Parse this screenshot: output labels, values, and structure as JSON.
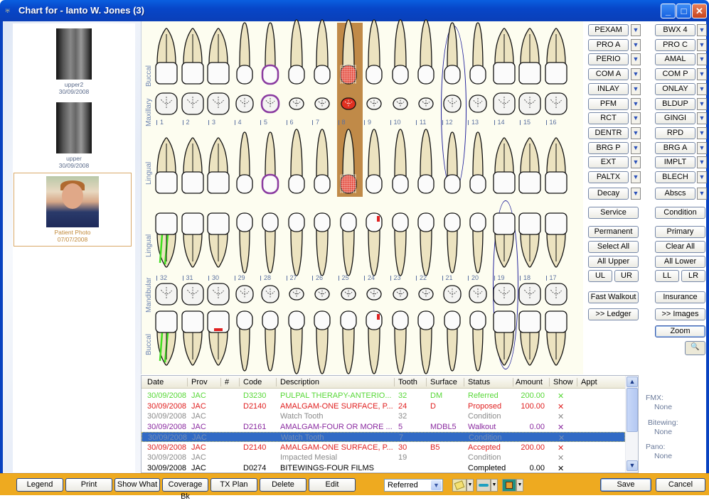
{
  "window": {
    "title": "Chart for - Ianto W. Jones (3)",
    "controls": {
      "minimize": "_",
      "maximize": "□",
      "close": "✕"
    }
  },
  "images_panel": {
    "items": [
      {
        "label": "upper2",
        "date": "30/09/2008",
        "type": "xray"
      },
      {
        "label": "upper",
        "date": "30/09/2008",
        "type": "xray"
      },
      {
        "label": "Patient Photo",
        "date": "07/07/2008",
        "type": "photo",
        "selected": true
      }
    ]
  },
  "chart": {
    "labels": {
      "upper_buccal": "Buccal",
      "maxillary": "Maxillary",
      "upper_lingual": "Lingual",
      "lower_lingual": "Lingual",
      "mandibular": "Mandibular",
      "lower_buccal": "Buccal"
    },
    "upper_teeth": [
      "1",
      "2",
      "3",
      "4",
      "5",
      "6",
      "7",
      "8",
      "9",
      "10",
      "11",
      "12",
      "13",
      "14",
      "15",
      "16"
    ],
    "lower_teeth": [
      "32",
      "31",
      "30",
      "29",
      "28",
      "27",
      "26",
      "25",
      "24",
      "23",
      "22",
      "21",
      "20",
      "19",
      "18",
      "17"
    ],
    "selected_tooth": "8",
    "circled_teeth": [
      "12",
      "19"
    ],
    "colors": {
      "selected_bg": "#c08a48",
      "crown_pattern": "#e03020",
      "walkout": "#8a3aa0",
      "referred": "#40e020",
      "proposed": "#e02020",
      "circle": "#20209a"
    }
  },
  "procedure_buttons": {
    "left": [
      "PEXAM",
      "PRO A",
      "PERIO",
      "COM A",
      "INLAY",
      "PFM",
      "RCT",
      "DENTR",
      "BRG P",
      "EXT",
      "PALTX"
    ],
    "right": [
      "BWX 4",
      "PRO C",
      "AMAL",
      "COM P",
      "ONLAY",
      "BLDUP",
      "GINGI",
      "RPD",
      "BRG A",
      "IMPLT",
      "BLECH"
    ],
    "decay": "Decay",
    "abscs": "Abscs"
  },
  "action_buttons": {
    "service": "Service",
    "condition": "Condition",
    "permanent": "Permanent",
    "primary": "Primary",
    "select_all": "Select All",
    "clear_all": "Clear All",
    "all_upper": "All Upper",
    "all_lower": "All Lower",
    "ul": "UL",
    "ur": "UR",
    "ll": "LL",
    "lr": "LR",
    "fast_walkout": "Fast Walkout",
    "insurance": "Insurance",
    "ledger": ">> Ledger",
    "images": ">> Images",
    "zoom": "Zoom"
  },
  "table": {
    "columns": [
      "Date",
      "Prov",
      "#",
      "Code",
      "Description",
      "Tooth",
      "Surface",
      "Status",
      "Amount",
      "Show",
      "Appt"
    ],
    "rows": [
      {
        "date": "30/09/2008",
        "prov": "JAC",
        "num": "",
        "code": "D3230",
        "desc": "PULPAL THERAPY-ANTERIO...",
        "tooth": "32",
        "surface": "DM",
        "status": "Referred",
        "amount": "200.00",
        "show": "✕",
        "appt": "",
        "color": "#58d838"
      },
      {
        "date": "30/09/2008",
        "prov": "JAC",
        "num": "",
        "code": "D2140",
        "desc": "AMALGAM-ONE SURFACE, P...",
        "tooth": "24",
        "surface": "D",
        "status": "Proposed",
        "amount": "100.00",
        "show": "✕",
        "appt": "",
        "color": "#e02020"
      },
      {
        "date": "30/09/2008",
        "prov": "JAC",
        "num": "",
        "code": "",
        "desc": "Watch Tooth",
        "tooth": "32",
        "surface": "",
        "status": "Condition",
        "amount": "",
        "show": "✕",
        "appt": "",
        "color": "#8a8a8a"
      },
      {
        "date": "30/09/2008",
        "prov": "JAC",
        "num": "",
        "code": "D2161",
        "desc": "AMALGAM-FOUR OR MORE ...",
        "tooth": "5",
        "surface": "MDBL5",
        "status": "Walkout",
        "amount": "0.00",
        "show": "✕",
        "appt": "",
        "color": "#8a2aa0"
      },
      {
        "date": "30/09/2008",
        "prov": "JAC",
        "num": "",
        "code": "",
        "desc": "Watch Tooth",
        "tooth": "7",
        "surface": "",
        "status": "Condition",
        "amount": "",
        "show": "✕",
        "appt": "",
        "color": "#7890b8",
        "selected": true
      },
      {
        "date": "30/09/2008",
        "prov": "JAC",
        "num": "",
        "code": "D2140",
        "desc": "AMALGAM-ONE SURFACE, P...",
        "tooth": "30",
        "surface": "B5",
        "status": "Accepted",
        "amount": "200.00",
        "show": "✕",
        "appt": "",
        "color": "#e02020"
      },
      {
        "date": "30/09/2008",
        "prov": "JAC",
        "num": "",
        "code": "",
        "desc": "Impacted Mesial",
        "tooth": "19",
        "surface": "",
        "status": "Condition",
        "amount": "",
        "show": "✕",
        "appt": "",
        "color": "#8a8a8a"
      },
      {
        "date": "30/09/2008",
        "prov": "JAC",
        "num": "",
        "code": "D0274",
        "desc": "BITEWINGS-FOUR FILMS",
        "tooth": "",
        "surface": "",
        "status": "Completed",
        "amount": "0.00",
        "show": "✕",
        "appt": "",
        "color": "#000000"
      }
    ]
  },
  "xray_info": {
    "fmx_label": "FMX:",
    "fmx_value": "None",
    "bitewing_label": "Bitewing:",
    "bitewing_value": "None",
    "pano_label": "Pano:",
    "pano_value": "None"
  },
  "bottom_bar": {
    "legend": "Legend",
    "print": "Print",
    "show_what": "Show What",
    "coverage_bk": "Coverage Bk",
    "tx_plan": "TX Plan",
    "delete": "Delete",
    "edit": "Edit",
    "status_select": "Referred",
    "save": "Save",
    "cancel": "Cancel"
  }
}
